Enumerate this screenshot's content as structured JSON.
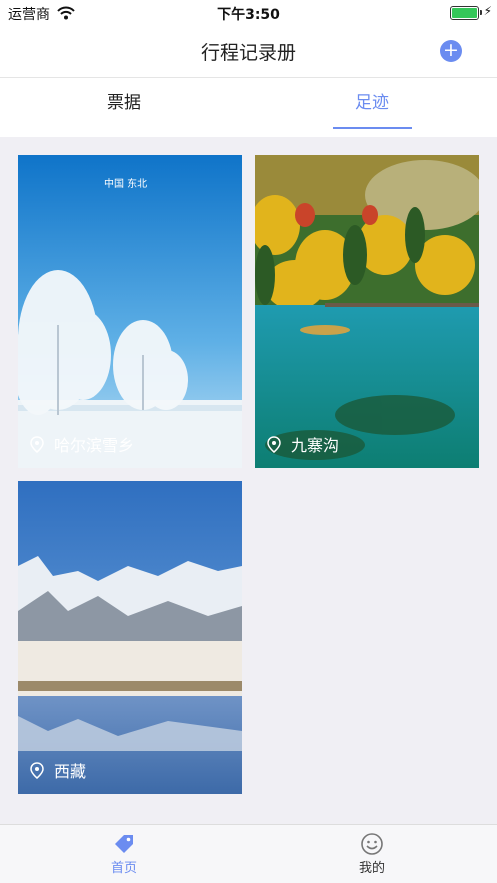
{
  "status_bar": {
    "carrier": "运营商",
    "time": "下午3:50"
  },
  "nav": {
    "title": "行程记录册",
    "add_icon": "plus-circle-icon"
  },
  "tabs": [
    {
      "label": "票据"
    },
    {
      "label": "足迹"
    }
  ],
  "footprints": [
    {
      "location": "哈尔滨雪乡",
      "watermark": "中国 东北"
    },
    {
      "location": "九寨沟"
    },
    {
      "location": "西藏"
    }
  ],
  "tab_bar": {
    "items": [
      {
        "label": "首页",
        "icon": "tag-icon"
      },
      {
        "label": "我的",
        "icon": "smiley-icon"
      }
    ]
  },
  "colors": {
    "accent": "#6b8cf0",
    "background": "#f0eff4"
  }
}
